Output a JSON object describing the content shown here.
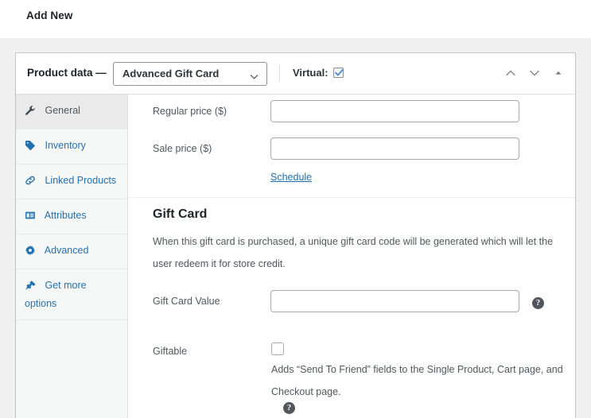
{
  "page": {
    "title": "Add New"
  },
  "panel": {
    "header_label": "Product data —",
    "product_type": {
      "selected": "Advanced Gift Card",
      "chevron_icon": "chevron-down-icon"
    },
    "virtual": {
      "label": "Virtual:",
      "checked": true,
      "check_color": "#4a8fd4"
    },
    "controls": [
      {
        "name": "move-up-button",
        "icon": "chevron-up-icon"
      },
      {
        "name": "move-down-button",
        "icon": "chevron-down-icon"
      },
      {
        "name": "toggle-panel-button",
        "icon": "triangle-up-icon"
      }
    ]
  },
  "tabs": [
    {
      "label": "General",
      "icon": "wrench-icon",
      "active": true
    },
    {
      "label": "Inventory",
      "icon": "tag-icon",
      "active": false
    },
    {
      "label": "Linked Products",
      "icon": "link-icon",
      "active": false
    },
    {
      "label": "Attributes",
      "icon": "attributes-icon",
      "active": false
    },
    {
      "label": "Advanced",
      "icon": "gear-icon",
      "active": false
    },
    {
      "label": "Get more options",
      "icon": "plug-icon",
      "active": false
    }
  ],
  "general": {
    "regular_price": {
      "label": "Regular price ($)",
      "value": "",
      "placeholder": ""
    },
    "sale_price": {
      "label": "Sale price ($)",
      "value": "",
      "placeholder": ""
    },
    "schedule_link": "Schedule"
  },
  "gift_card": {
    "heading": "Gift Card",
    "description": "When this gift card is purchased, a unique gift card code will be generated which will let the user redeem it for store credit.",
    "value_field": {
      "label": "Gift Card Value",
      "value": "",
      "placeholder": "",
      "help": "?"
    },
    "giftable": {
      "label": "Giftable",
      "checked": false,
      "description": "Adds “Send To Friend” fields to the Single Product, Cart page, and Checkout page.",
      "help": "?"
    }
  },
  "colors": {
    "link": "#2271b1",
    "page_background": "#f0f0f1",
    "panel_background": "#ffffff",
    "sidebar_background": "#f6f7f7",
    "active_tab_background": "#eaeaea"
  }
}
